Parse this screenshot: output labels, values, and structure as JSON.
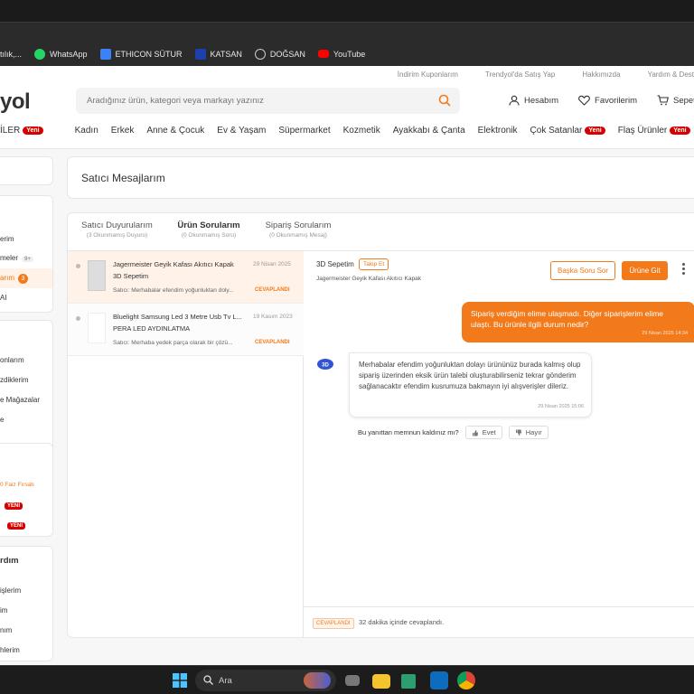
{
  "bookmarks": [
    {
      "label": "tılık,...",
      "icon": "folder-icon",
      "color": "#e8e8e8"
    },
    {
      "label": "WhatsApp",
      "icon": "whatsapp-icon",
      "color": "#25d366"
    },
    {
      "label": "ETHICON SÜTUR",
      "icon": "bookmark-icon",
      "color": "#3b82f6"
    },
    {
      "label": "KATSAN",
      "icon": "bookmark-icon",
      "color": "#1e40af"
    },
    {
      "label": "DOĞSAN",
      "icon": "globe-icon",
      "color": "#cccccc"
    },
    {
      "label": "YouTube",
      "icon": "youtube-icon",
      "color": "#ff0000"
    }
  ],
  "header": {
    "toplinks": [
      "İndirim Kuponlarım",
      "Trendyol'da Satış Yap",
      "Hakkımızda",
      "Yardım & Dest"
    ],
    "logo": "yol",
    "search_placeholder": "Aradığınız ürün, kategori veya markayı yazınız",
    "account": "Hesabım",
    "favorites": "Favorilerim",
    "cart": "Sepet"
  },
  "categories": [
    {
      "label": "İLER",
      "badge": "Yeni"
    },
    {
      "label": "Kadın",
      "badge": ""
    },
    {
      "label": "Erkek",
      "badge": ""
    },
    {
      "label": "Anne & Çocuk",
      "badge": ""
    },
    {
      "label": "Ev & Yaşam",
      "badge": ""
    },
    {
      "label": "Süpermarket",
      "badge": ""
    },
    {
      "label": "Kozmetik",
      "badge": ""
    },
    {
      "label": "Ayakkabı & Çanta",
      "badge": ""
    },
    {
      "label": "Elektronik",
      "badge": ""
    },
    {
      "label": "Çok Satanlar",
      "badge": "Yeni"
    },
    {
      "label": "Flaş Ürünler",
      "badge": "Yeni"
    }
  ],
  "sidebar": {
    "block1": [
      "erim",
      "meler",
      "arım"
    ],
    "block1_counts": {
      "meler": "9+",
      "arım": "3"
    },
    "block1_extra": "AI",
    "block2": [
      "onlarım",
      "zdiklerim",
      "e Mağazalar",
      "e"
    ],
    "block3_promo": "0 Faiz Fırsatı",
    "block3_new": [
      "YENİ",
      "YENİ"
    ],
    "block4_title": "rdım",
    "block4": [
      "işlerim",
      "im",
      "nım",
      "hlerim"
    ]
  },
  "page_title": "Satıcı Mesajlarım",
  "tabs": [
    {
      "label": "Satıcı Duyurularım",
      "sub": "(3 Okunmamış Duyuru)",
      "active": false
    },
    {
      "label": "Ürün Sorularım",
      "sub": "(0 Okunmamış Soru)",
      "active": true
    },
    {
      "label": "Sipariş Sorularım",
      "sub": "(0 Okunmamış Mesaj)",
      "active": false
    }
  ],
  "conversations": [
    {
      "product": "Jagermeister Geyik Kafası Akıtıcı Kapak",
      "store": "3D Sepetim",
      "date": "29 Nisan 2025",
      "preview": "Satıcı: Merhabalar efendim yoğunluktan doly...",
      "status": "CEVAPLANDI",
      "selected": true
    },
    {
      "product": "Bluelight Samsung Led 3 Metre Usb Tv L...",
      "store": "PERA LED AYDINLATMA",
      "date": "19 Kasım 2023",
      "preview": "Satıcı: Merhaba yedek parça olarak bir çözü...",
      "status": "CEVAPLANDI",
      "selected": false
    }
  ],
  "chat": {
    "seller": "3D Sepetim",
    "follow": "Takip Et",
    "product": "Jagermeister Geyik Kafası Akıtıcı Kapak",
    "ask_other": "Başka Soru Sor",
    "go_product": "Ürüne Git",
    "my_message": "Sipariş verdiğim elime ulaşmadı. Diğer siparişlerim elime ulaştı. Bu ürünle ilgili durum nedir?",
    "my_time": "29 Nisan 2025 14:34",
    "seller_message": "Merhabalar efendim yoğunluktan dolayı ürününüz burada kalmış olup sipariş üzerinden eksik ürün talebi oluşturabilirseniz tekrar gönderim sağlanacaktır efendim kusrumuza bakmayın iyi alışverişler dileriz.",
    "seller_time": "29 Nisan 2025 15:06",
    "feedback_q": "Bu yanıttan memnun kaldınız mı?",
    "yes": "Evet",
    "no": "Hayır",
    "footer_badge": "CEVAPLANDI",
    "footer_text": "32 dakika içinde cevaplandı."
  },
  "taskbar": {
    "search": "Ara"
  },
  "colors": {
    "accent": "#f27a1a",
    "badge": "#d60000"
  }
}
